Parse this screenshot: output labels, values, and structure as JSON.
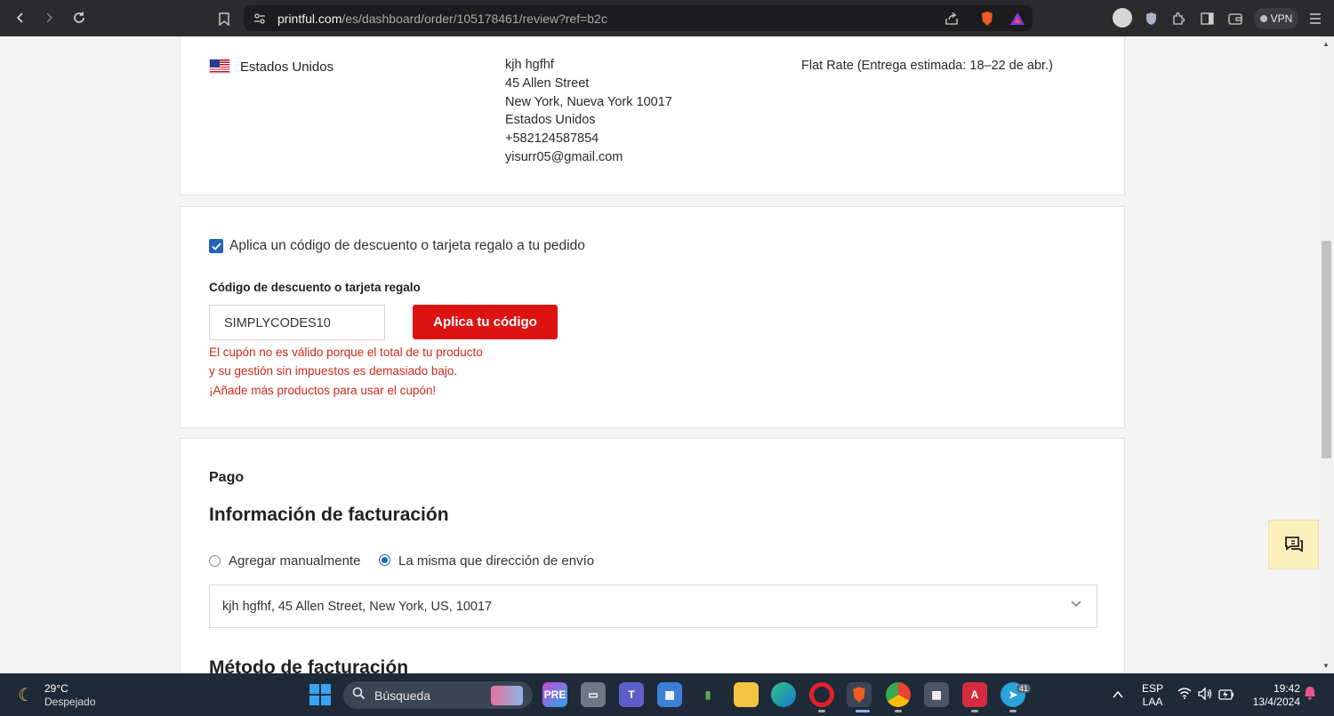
{
  "browser": {
    "url_host": "printful.com",
    "url_path": "/es/dashboard/order/105178461/review?ref=b2c",
    "vpn_label": "VPN",
    "icons": [
      "back-icon",
      "forward-icon",
      "reload-icon",
      "bookmark-icon",
      "site-settings-icon",
      "share-icon",
      "brave-shield-icon",
      "brave-rewards-icon",
      "profile-icon",
      "shield-icon",
      "extensions-icon",
      "sidebar-icon",
      "wallet-icon",
      "menu-icon"
    ]
  },
  "shipping": {
    "country": "Estados Unidos",
    "address_lines": [
      "kjh hgfhf",
      "45 Allen Street",
      "New York, Nueva York 10017",
      "Estados Unidos",
      "+582124587854",
      "yisurr05@gmail.com"
    ],
    "method": "Flat Rate (Entrega estimada: 18–22 de abr.)"
  },
  "discount": {
    "checkbox_label": "Aplica un código de descuento o tarjeta regalo a tu pedido",
    "checked": true,
    "field_label": "Código de descuento o tarjeta regalo",
    "code_value": "SIMPLYCODES10",
    "apply_button": "Aplica tu código",
    "error_lines": [
      "El cupón no es válido porque el total de tu producto",
      "y su gestión sin impuestos es demasiado bajo.",
      "¡Añade más productos para usar el cupón!"
    ],
    "error_color": "#d02a1a",
    "button_color": "#dd1212"
  },
  "payment": {
    "section_label": "Pago",
    "billing_title": "Información de facturación",
    "radio_manual": "Agregar manualmente",
    "radio_same": "La misma que dirección de envío",
    "selected_radio": "same",
    "address_select_value": "kjh hgfhf, 45 Allen Street, New York, US, 10017",
    "billing_method_title": "Método de facturación"
  },
  "taskbar": {
    "temperature": "29°C",
    "weather": "Despejado",
    "search_placeholder": "Búsqueda",
    "language_top": "ESP",
    "language_bottom": "LAA",
    "time": "19:42",
    "date": "13/4/2024",
    "telegram_badge": "41"
  }
}
